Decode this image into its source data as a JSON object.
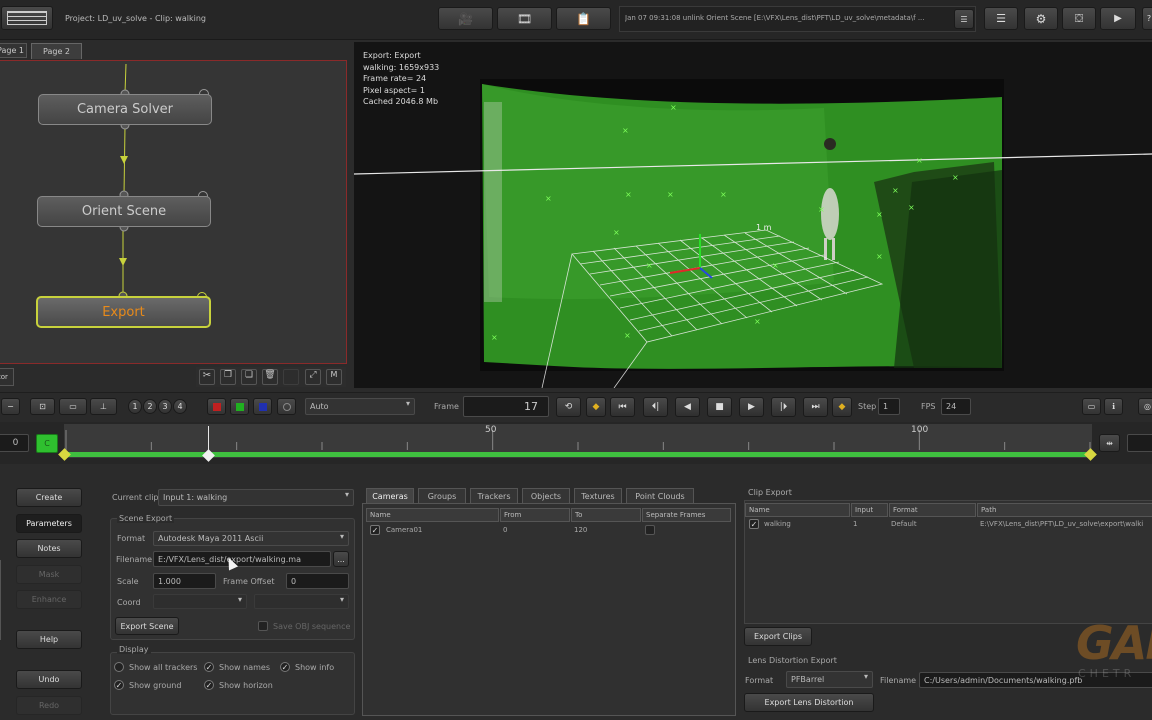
{
  "topbar": {
    "project_text": "Project: LD_uv_solve - Clip: walking",
    "log_text": "Jan 07 09:31:08 unlink Orient Scene [E:\\VFX\\Lens_dist\\PFT\\LD_uv_solve\\metadata\\f ...",
    "help_label": "?"
  },
  "node_tabs": [
    "Page 1",
    "Page 2"
  ],
  "nodes": {
    "camera_solver": "Camera Solver",
    "orient_scene": "Orient Scene",
    "export": "Export"
  },
  "node_panel": {
    "status_label": "tor"
  },
  "viewer": {
    "info": [
      "Export: Export",
      "walking: 1659x933",
      "Frame rate= 24",
      "Pixel aspect= 1",
      "Cached 2046.8 Mb"
    ],
    "grid_label": "1 m"
  },
  "transport": {
    "layer_numbers": [
      "1",
      "2",
      "3",
      "4"
    ],
    "view_mode": "Auto",
    "frame_label": "Frame",
    "frame_value": "17",
    "step_label": "Step",
    "step_value": "1",
    "fps_label": "FPS",
    "fps_value": "24"
  },
  "timeline": {
    "start_field": "0",
    "key_label": "C",
    "ticks": [
      "50",
      "100"
    ],
    "current_frame": 17,
    "range_start": 0,
    "range_end": 120
  },
  "sidebar_buttons": {
    "create": "Create",
    "parameters": "Parameters",
    "notes": "Notes",
    "mask": "Mask",
    "enhance": "Enhance",
    "help": "Help",
    "undo": "Undo",
    "redo": "Redo"
  },
  "params": {
    "current_clip_label": "Current clip",
    "current_clip_value": "Input 1: walking",
    "scene_export_title": "Scene Export",
    "format_label": "Format",
    "format_value": "Autodesk Maya 2011 Ascii",
    "filename_label": "Filename",
    "filename_value": "E:/VFX/Lens_dist/export/walking.ma",
    "browse_label": "...",
    "scale_label": "Scale",
    "scale_value": "1.000",
    "frame_offset_label": "Frame Offset",
    "frame_offset_value": "0",
    "coord_label": "Coord",
    "export_scene_label": "Export Scene",
    "save_obj_label": "Save OBJ sequence",
    "display_title": "Display",
    "show_all_trackers": "Show all trackers",
    "show_names": "Show names",
    "show_info": "Show info",
    "show_ground": "Show ground",
    "show_horizon": "Show horizon"
  },
  "export_tabs": [
    "Cameras",
    "Groups",
    "Trackers",
    "Objects",
    "Textures",
    "Point Clouds"
  ],
  "camera_table": {
    "headers": [
      "Name",
      "From",
      "To",
      "Separate Frames"
    ],
    "rows": [
      {
        "name": "Camera01",
        "from": "0",
        "to": "120"
      }
    ]
  },
  "clip_export": {
    "title": "Clip Export",
    "headers": [
      "Name",
      "Input",
      "Format",
      "Path"
    ],
    "rows": [
      {
        "name": "walking",
        "input": "1",
        "format": "Default",
        "path": "E:\\VFX\\Lens_dist\\PFT\\LD_uv_solve\\export\\walki"
      }
    ],
    "export_clips_label": "Export Clips",
    "lens_title": "Lens Distortion Export",
    "format_label": "Format",
    "format_value": "PFBarrel",
    "filename_label": "Filename",
    "filename_value": "C:/Users/admin/Documents/walking.pfb",
    "export_lens_label": "Export Lens Distortion"
  },
  "watermark": {
    "big": "GAF",
    "small": "CHETR"
  },
  "colors": {
    "accent_green": "#3fbf3f",
    "export_node": "#e88a1a",
    "node_link": "#c8d23c"
  }
}
